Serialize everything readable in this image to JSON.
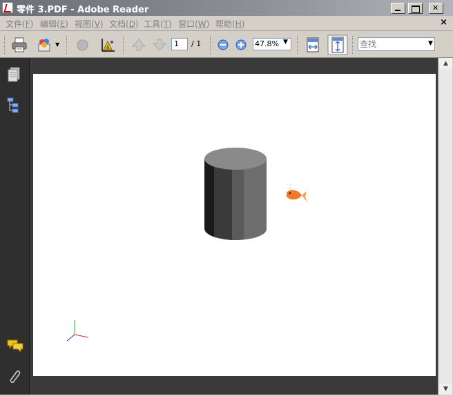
{
  "window": {
    "title": "零件 3.PDF - Adobe Reader"
  },
  "menu": [
    {
      "label": "文件(",
      "key": "F",
      "suffix": ")"
    },
    {
      "label": "编辑(",
      "key": "E",
      "suffix": ")"
    },
    {
      "label": "视图(",
      "key": "V",
      "suffix": ")"
    },
    {
      "label": "文档(",
      "key": "D",
      "suffix": ")"
    },
    {
      "label": "工具(",
      "key": "T",
      "suffix": ")"
    },
    {
      "label": "窗口(",
      "key": "W",
      "suffix": ")"
    },
    {
      "label": "帮助(",
      "key": "H",
      "suffix": ")"
    }
  ],
  "toolbar": {
    "page_current": "1",
    "page_total": "/ 1",
    "zoom": "47.8%",
    "search_placeholder": "查找"
  },
  "colors": {
    "titlebar": "#8f9298",
    "panel": "#2f2f2f",
    "cylinder_top": "#8a8a8a",
    "cylinder_front": "#6e6e6e",
    "cylinder_dark": "#3a3a3a",
    "fish": "#f07a2a"
  }
}
